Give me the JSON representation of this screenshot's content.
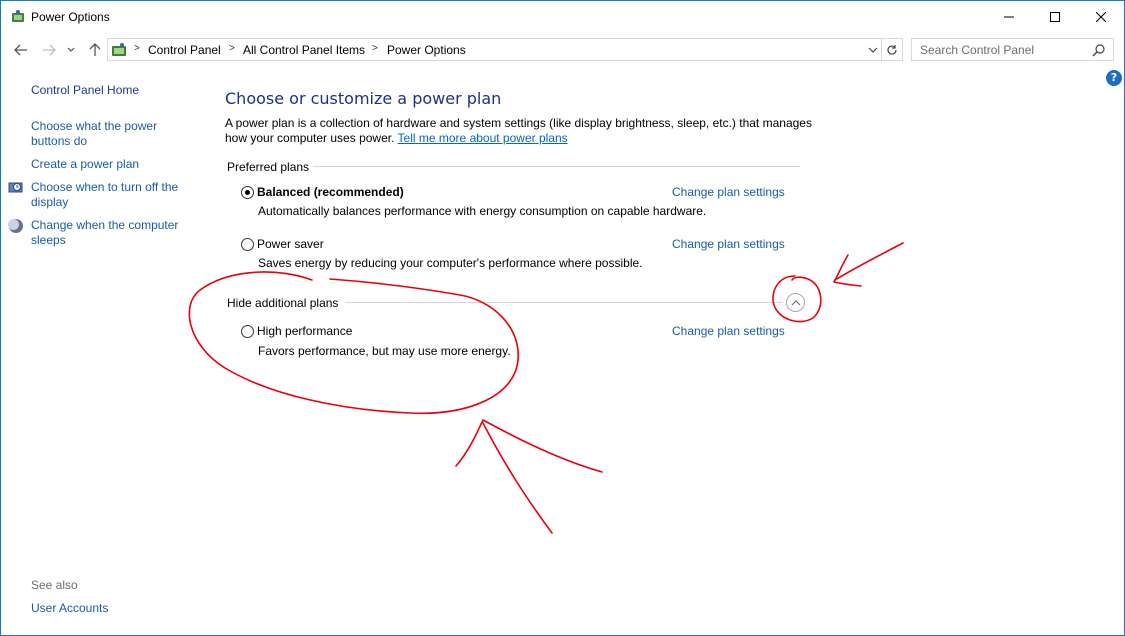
{
  "window": {
    "title": "Power Options",
    "controls": {
      "minimize": "minimize",
      "maximize": "maximize",
      "close": "close"
    }
  },
  "address_bar": {
    "crumbs": [
      "Control Panel",
      "All Control Panel Items",
      "Power Options"
    ],
    "search_placeholder": "Search Control Panel"
  },
  "sidebar": {
    "home": "Control Panel Home",
    "links": [
      {
        "label": "Choose what the power buttons do",
        "lines": [
          "Choose what the power",
          "buttons do"
        ]
      },
      {
        "label": "Create a power plan",
        "lines": [
          "Create a power plan"
        ]
      },
      {
        "label": "Choose when to turn off the display",
        "lines": [
          "Choose when to turn off the",
          "display"
        ],
        "icon": "monitor-clock-icon"
      },
      {
        "label": "Change when the computer sleeps",
        "lines": [
          "Change when the computer",
          "sleeps"
        ],
        "icon": "moon-icon"
      }
    ],
    "see_also": "See also",
    "user_accounts": "User Accounts"
  },
  "main": {
    "heading": "Choose or customize a power plan",
    "description": "A power plan is a collection of hardware and system settings (like display brightness, sleep, etc.) that manages how your computer uses power.",
    "tell_more": "Tell me more about power plans",
    "preferred_label": "Preferred plans",
    "additional_label": "Hide additional plans",
    "change_link": "Change plan settings",
    "plans": [
      {
        "name": "Balanced (recommended)",
        "desc": "Automatically balances performance with energy consumption on capable hardware.",
        "selected": true
      },
      {
        "name": "Power saver",
        "desc": "Saves energy by reducing your computer's performance where possible.",
        "selected": false
      },
      {
        "name": "High performance",
        "desc": "Favors performance, but may use more energy.",
        "selected": false
      }
    ]
  },
  "annotations": {
    "color": "#e8000b"
  },
  "colors": {
    "link": "#1a5aa8",
    "heading": "#1e3287",
    "border": "#1979ca"
  }
}
